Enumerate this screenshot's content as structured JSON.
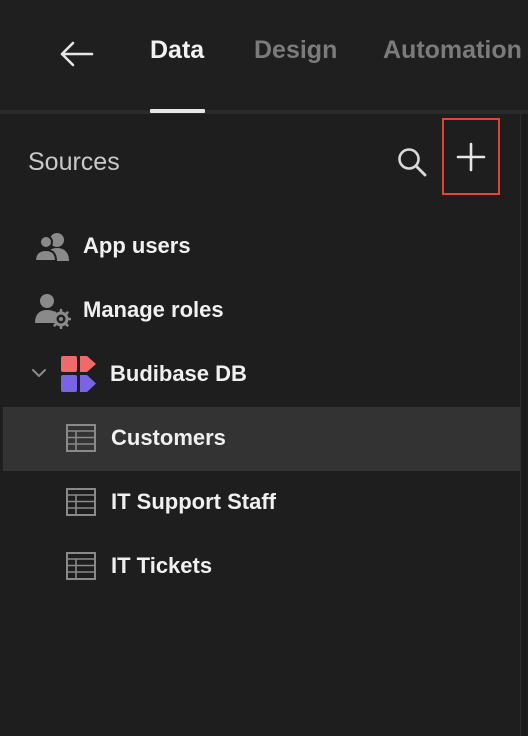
{
  "topnav": {
    "tabs": [
      {
        "label": "Data",
        "active": true
      },
      {
        "label": "Design",
        "active": false
      },
      {
        "label": "Automation",
        "active": false
      }
    ]
  },
  "sources": {
    "title": "Sources",
    "items": [
      {
        "label": "App users",
        "icon": "users-icon"
      },
      {
        "label": "Manage roles",
        "icon": "user-gear-icon"
      },
      {
        "label": "Budibase DB",
        "icon": "budibase-logo-icon",
        "expanded": true
      },
      {
        "label": "Customers",
        "icon": "table-icon",
        "selected": true
      },
      {
        "label": "IT Support Staff",
        "icon": "table-icon"
      },
      {
        "label": "IT Tickets",
        "icon": "table-icon"
      }
    ]
  },
  "colors": {
    "background": "#1e1e1e",
    "selected_row": "#333333",
    "highlight_border": "#e2463a",
    "active_tab": "#f2f2f2",
    "inactive_tab": "#7b7b7b"
  }
}
